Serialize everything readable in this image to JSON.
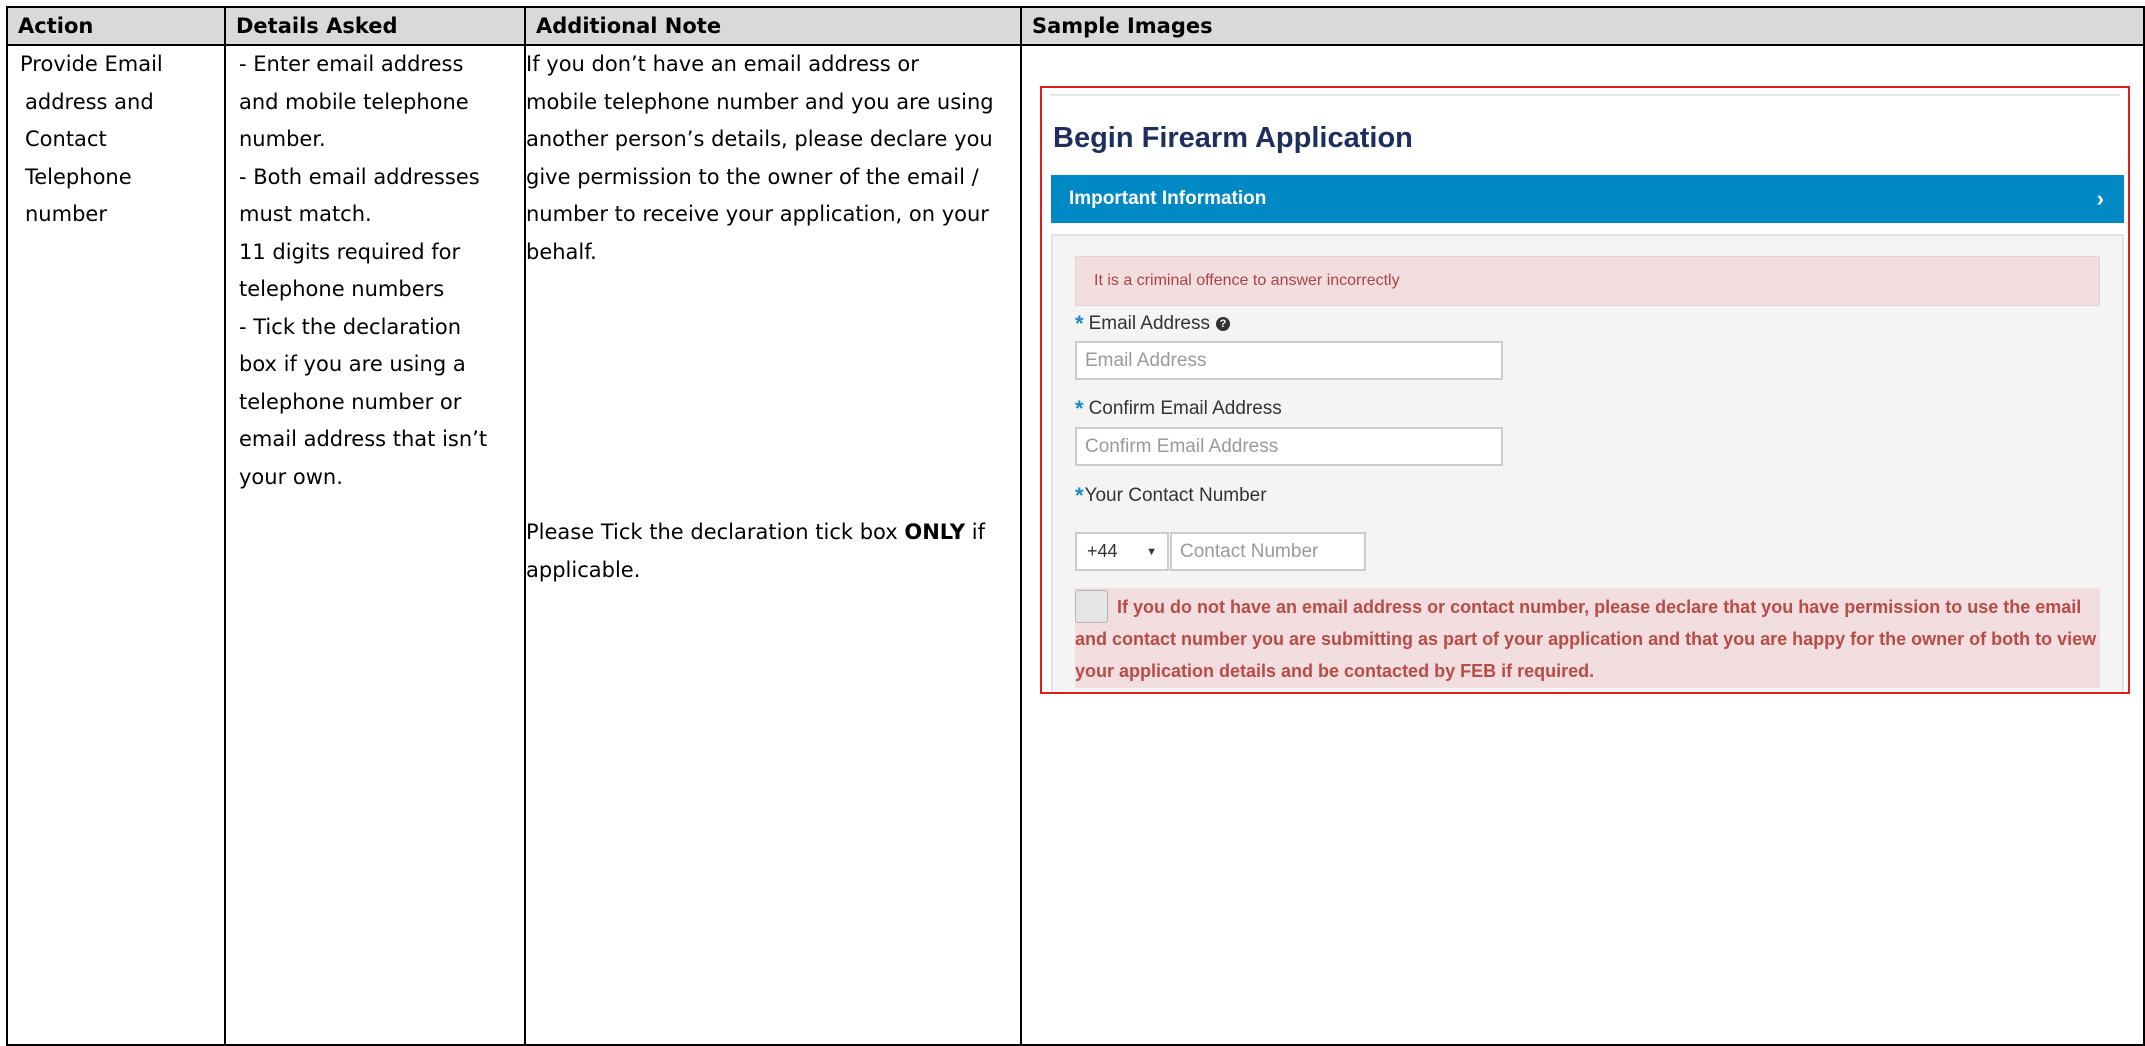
{
  "headers": {
    "action": "Action",
    "details": "Details Asked",
    "note": "Additional Note",
    "images": "Sample Images"
  },
  "row": {
    "action_lines": [
      "Provide Email",
      "address and",
      "Contact",
      "Telephone",
      "number"
    ],
    "details_lines": [
      "- Enter email address",
      "and mobile telephone",
      "number.",
      "- Both email addresses",
      "must match.",
      "11 digits required for",
      "telephone numbers",
      "- Tick the declaration",
      "box if you are using a",
      "telephone number or",
      "email address that isn’t",
      "your own."
    ],
    "note_lines": [
      "If you don’t have an email address or",
      "mobile telephone number and you are using",
      "another person’s details, please declare you",
      "give permission to the owner of the email /",
      "number to receive your application, on your",
      "behalf."
    ],
    "note2": {
      "before": "Please Tick the declaration tick box ",
      "bold": "ONLY",
      "after": " if",
      "line2": "applicable."
    }
  },
  "sample_form": {
    "title": "Begin Firearm Application",
    "info_bar_label": "Important Information",
    "info_bar_icon": "chevron-right-icon",
    "warning": "It is a criminal offence to answer incorrectly",
    "email_label": "Email Address",
    "email_placeholder": "Email Address",
    "confirm_email_label": "Confirm Email Address",
    "confirm_email_placeholder": "Confirm Email Address",
    "contact_label": "Your Contact Number",
    "country_code": "+44",
    "contact_placeholder": "Contact Number",
    "declaration": "If you do not have an email address or contact number, please declare that you have permission to use the email and contact number you are submitting as part of your application and that you are happy for the owner of both to view your application details and be contacted by FEB if required.",
    "required_mark": "*",
    "colors": {
      "frame": "#e21b1b",
      "title": "#1e2f5f",
      "info_bar": "#0089c5",
      "warning_bg": "#f2dede",
      "warning_text": "#a94442",
      "required": "#1b8ac8"
    }
  }
}
